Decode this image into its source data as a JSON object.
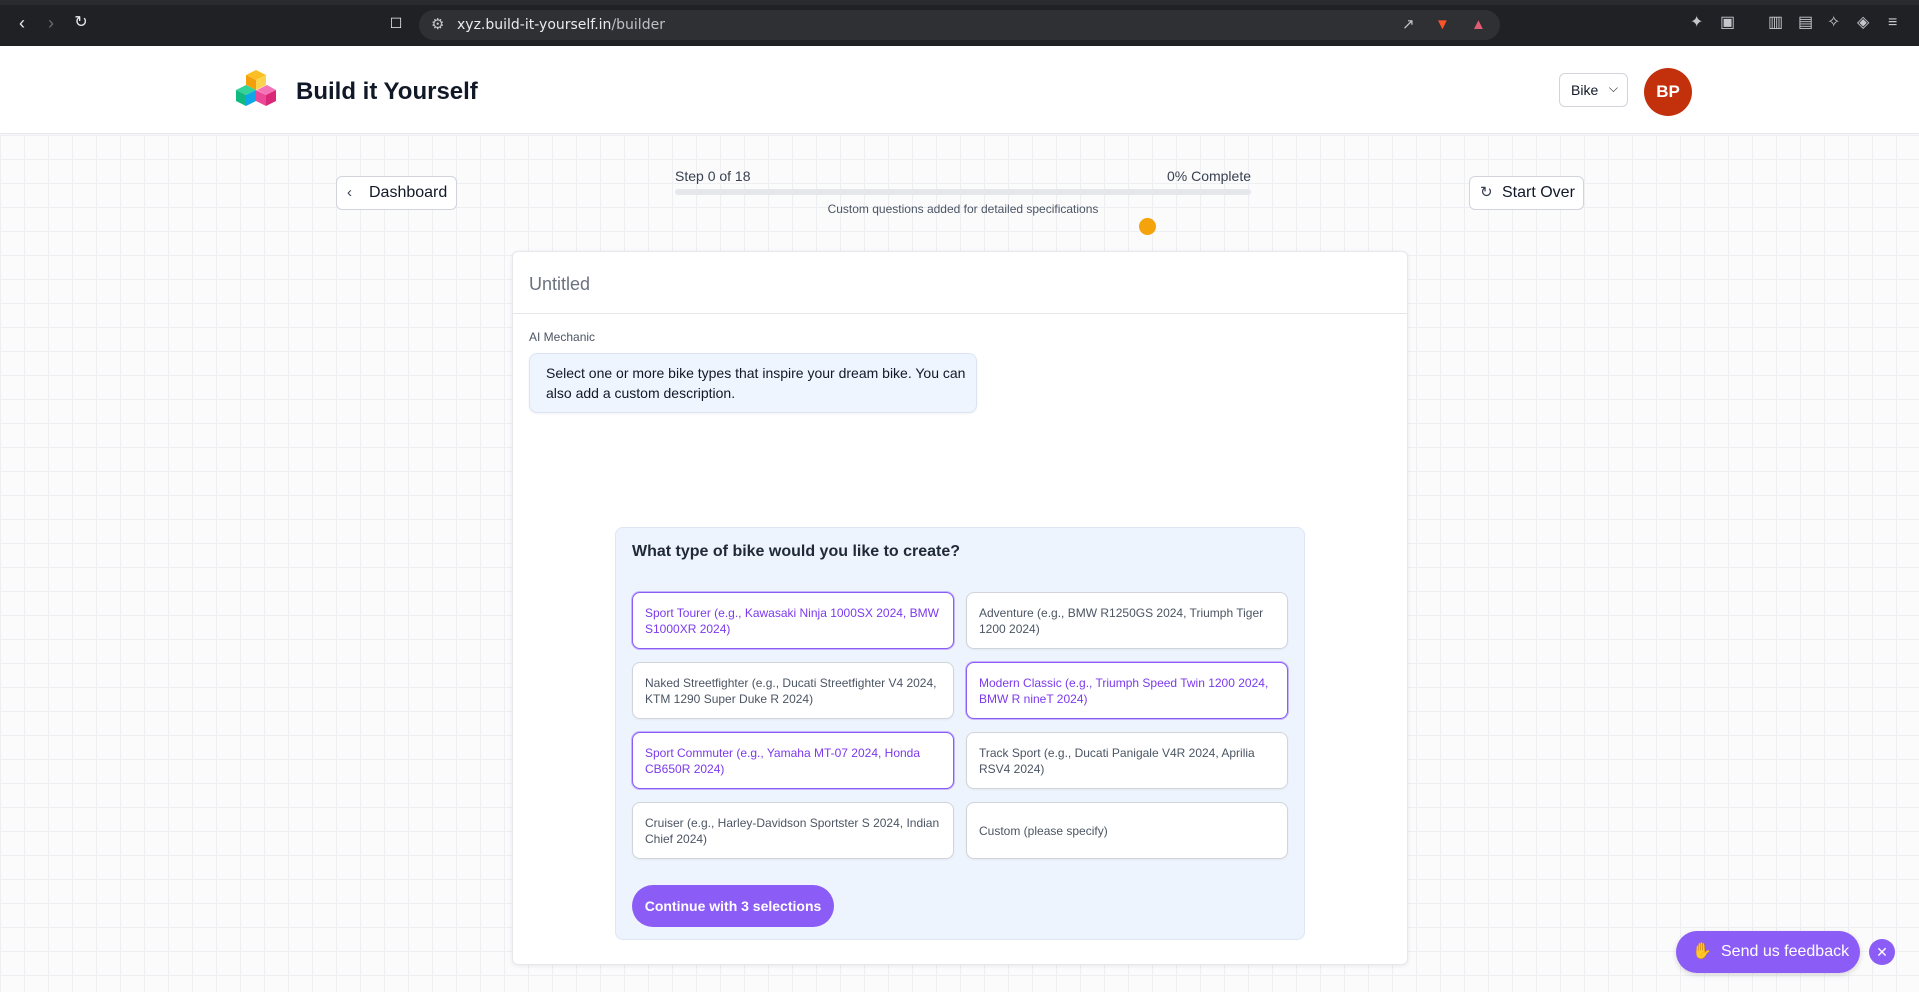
{
  "browser": {
    "url_host": "xyz.build-it-yourself.in",
    "url_path": "/builder",
    "back_icon": "chevron-left-icon",
    "forward_icon": "chevron-right-icon",
    "reload_icon": "reload-icon"
  },
  "header": {
    "brand": "Build it Yourself",
    "type_select_value": "Bike",
    "avatar_initials": "BP",
    "avatar_color": "#c2310c"
  },
  "toolbar": {
    "dashboard_label": "Dashboard",
    "start_over_label": "Start Over"
  },
  "progress": {
    "step_text": "Step 0 of 18",
    "complete_text": "0% Complete",
    "percent": 0,
    "note": "Custom questions added for detailed specifications"
  },
  "card": {
    "title": "Untitled",
    "sender": "AI Mechanic",
    "message": "Select one or more bike types that inspire your dream bike. You can also add a custom description."
  },
  "question": {
    "prompt": "What type of bike would you like to create?",
    "options": [
      {
        "label": "Sport Tourer (e.g., Kawasaki Ninja 1000SX 2024, BMW S1000XR 2024)",
        "selected": true
      },
      {
        "label": "Adventure (e.g., BMW R1250GS 2024, Triumph Tiger 1200 2024)",
        "selected": false
      },
      {
        "label": "Naked Streetfighter (e.g., Ducati Streetfighter V4 2024, KTM 1290 Super Duke R 2024)",
        "selected": false
      },
      {
        "label": "Modern Classic (e.g., Triumph Speed Twin 1200 2024, BMW R nineT 2024)",
        "selected": true
      },
      {
        "label": "Sport Commuter (e.g., Yamaha MT-07 2024, Honda CB650R 2024)",
        "selected": true
      },
      {
        "label": "Track Sport (e.g., Ducati Panigale V4R 2024, Aprilia RSV4 2024)",
        "selected": false
      },
      {
        "label": "Cruiser (e.g., Harley-Davidson Sportster S 2024, Indian Chief 2024)",
        "selected": false
      },
      {
        "label": "Custom (please specify)",
        "selected": false
      }
    ],
    "continue_label": "Continue with 3 selections"
  },
  "feedback": {
    "label": "Send us feedback"
  },
  "colors": {
    "accent": "#8b5cf6",
    "status_dot": "#f5a30a"
  }
}
